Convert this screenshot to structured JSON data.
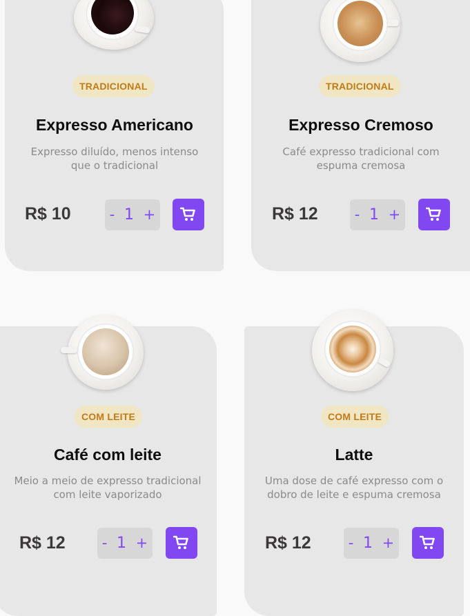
{
  "products": [
    {
      "tag": "TRADICIONAL",
      "name": "Expresso Americano",
      "description_line1": "Expresso diluído, menos intenso",
      "description_line2": "que o tradicional",
      "price": "R$ 10",
      "quantity": "1",
      "decrement": "-",
      "increment": "+",
      "cup_style": "black-coffee-cup"
    },
    {
      "tag": "TRADICIONAL",
      "name": "Expresso Cremoso",
      "description_line1": "Café expresso tradicional com",
      "description_line2": "espuma cremosa",
      "price": "R$ 12",
      "quantity": "1",
      "decrement": "-",
      "increment": "+",
      "cup_style": "cream-espresso-cup"
    },
    {
      "tag": "COM LEITE",
      "name": "Café com leite",
      "description_line1": "Meio a meio de expresso tradicional",
      "description_line2": "com leite vaporizado",
      "price": "R$ 12",
      "quantity": "1",
      "decrement": "-",
      "increment": "+",
      "cup_style": "milk-coffee-cup"
    },
    {
      "tag": "COM LEITE",
      "name": "Latte",
      "description_line1": "Uma dose de café expresso com o",
      "description_line2": "dobro de leite e espuma cremosa",
      "price": "R$ 12",
      "quantity": "1",
      "decrement": "-",
      "increment": "+",
      "cup_style": "latte-art-cup"
    }
  ],
  "colors": {
    "accent": "#8147f0",
    "tag_bg": "#f1e6c3",
    "tag_text": "#c07a17",
    "card_bg": "#e8e7e8",
    "page_bg": "#f9f9f9"
  },
  "icons": {
    "cart": "shopping-cart-icon"
  }
}
